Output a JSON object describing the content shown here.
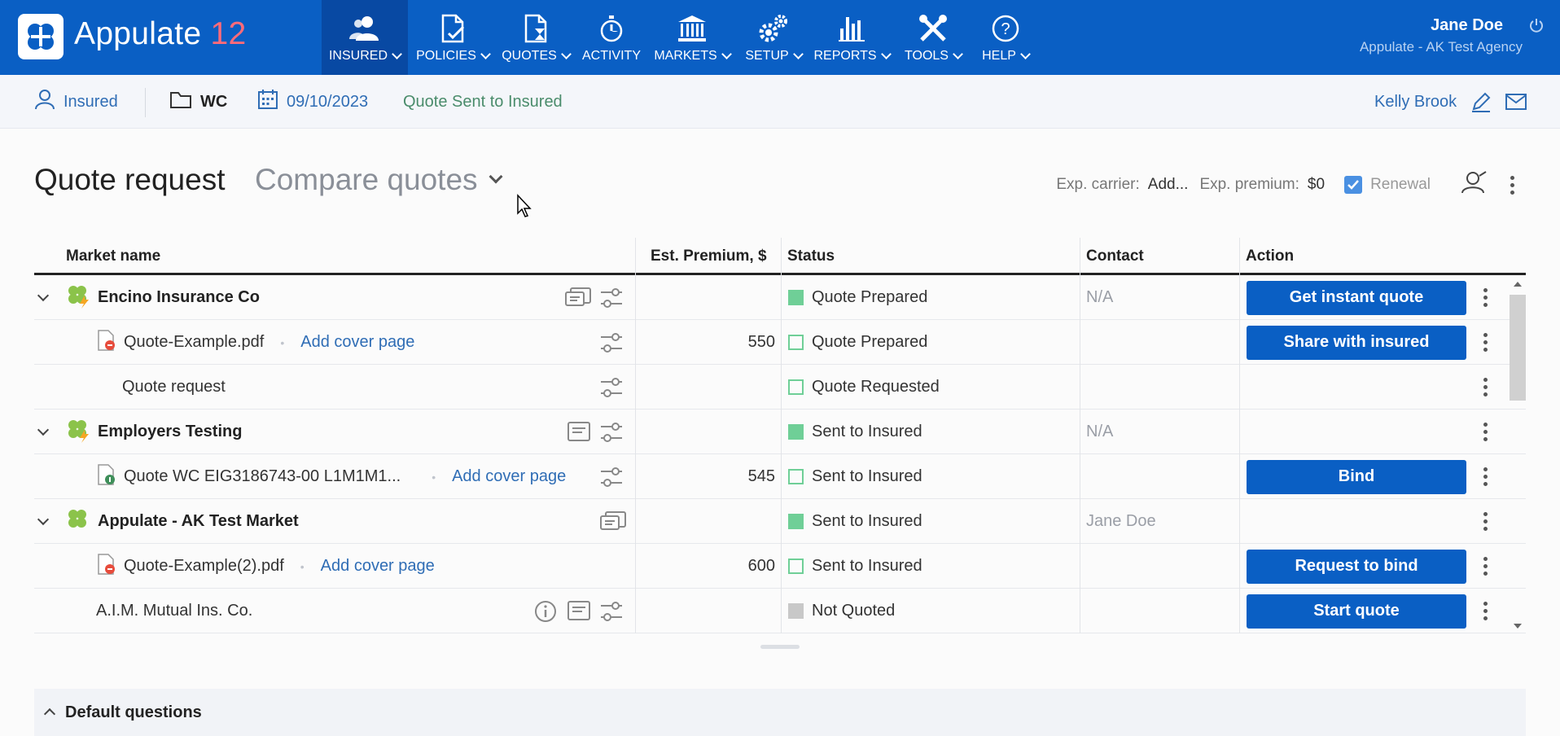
{
  "app": {
    "name": "Appulate",
    "version": "12"
  },
  "nav": {
    "items": [
      {
        "label": "INSURED",
        "icon": "users-icon",
        "active": true
      },
      {
        "label": "POLICIES",
        "icon": "document-check-icon",
        "active": false
      },
      {
        "label": "QUOTES",
        "icon": "hourglass-document-icon",
        "active": false
      },
      {
        "label": "ACTIVITY",
        "icon": "stopwatch-icon",
        "active": false
      },
      {
        "label": "MARKETS",
        "icon": "bank-icon",
        "active": false
      },
      {
        "label": "SETUP",
        "icon": "gears-icon",
        "active": false
      },
      {
        "label": "REPORTS",
        "icon": "bar-chart-icon",
        "active": false
      },
      {
        "label": "TOOLS",
        "icon": "tools-icon",
        "active": false
      },
      {
        "label": "HELP",
        "icon": "help-circle-icon",
        "active": false
      }
    ]
  },
  "user": {
    "name": "Jane Doe",
    "agency": "Appulate - AK Test Agency"
  },
  "subbar": {
    "insured": "Insured",
    "line": "WC",
    "date": "09/10/2023",
    "status": "Quote Sent to Insured",
    "agent": "Kelly Brook"
  },
  "heading": {
    "title": "Quote request",
    "compare": "Compare quotes",
    "exp_carrier_label": "Exp. carrier:",
    "exp_carrier_value": "Add...",
    "exp_premium_label": "Exp. premium:",
    "exp_premium_value": "$0",
    "renewal": "Renewal",
    "renewal_checked": true
  },
  "table": {
    "headers": {
      "market": "Market name",
      "premium": "Est. Premium, $",
      "status": "Status",
      "contact": "Contact",
      "action": "Action"
    },
    "rows": [
      {
        "type": "market",
        "name": "Encino Insurance Co",
        "premium": "",
        "status": "Quote Prepared",
        "status_style": "filled",
        "contact": "N/A",
        "action": "Get instant quote"
      },
      {
        "type": "file",
        "name": "Quote-Example.pdf",
        "cover": "Add cover page",
        "premium": "550",
        "status": "Quote Prepared",
        "status_style": "outline",
        "contact": "",
        "action": "Share with insured"
      },
      {
        "type": "request",
        "name": "Quote request",
        "premium": "",
        "status": "Quote Requested",
        "status_style": "outline",
        "contact": "",
        "action": ""
      },
      {
        "type": "market",
        "name": "Employers Testing",
        "premium": "",
        "status": "Sent to Insured",
        "status_style": "filled",
        "contact": "N/A",
        "action": ""
      },
      {
        "type": "file",
        "name": "Quote WC EIG3186743-00 L1M1M1...",
        "cover": "Add cover page",
        "premium": "545",
        "status": "Sent to Insured",
        "status_style": "outline",
        "contact": "",
        "action": "Bind"
      },
      {
        "type": "market",
        "name": "Appulate - AK Test Market",
        "premium": "",
        "status": "Sent to Insured",
        "status_style": "filled",
        "contact": "Jane Doe",
        "action": ""
      },
      {
        "type": "file",
        "name": "Quote-Example(2).pdf",
        "cover": "Add cover page",
        "premium": "600",
        "status": "Sent to Insured",
        "status_style": "outline",
        "contact": "",
        "action": "Request to bind"
      },
      {
        "type": "plain",
        "name": "A.I.M. Mutual Ins. Co.",
        "premium": "",
        "status": "Not Quoted",
        "status_style": "gray",
        "contact": "",
        "action": "Start quote"
      }
    ]
  },
  "default_questions": "Default questions",
  "colors": {
    "primary": "#0a5fc4",
    "status_green": "#6fcf97",
    "link": "#2f6db5"
  }
}
